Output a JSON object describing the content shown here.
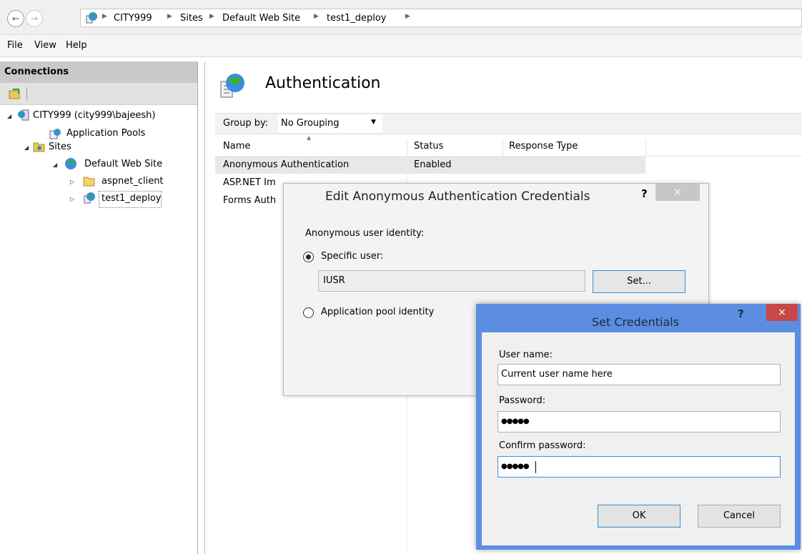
{
  "address": {
    "back_icon": "back-arrow-icon",
    "forward_icon": "forward-arrow-icon",
    "crumbs": [
      "CITY999",
      "Sites",
      "Default Web Site",
      "test1_deploy"
    ]
  },
  "menu": [
    "File",
    "View",
    "Help"
  ],
  "connections": {
    "title": "Connections",
    "tree": [
      "CITY999 (city999\\bajeesh)",
      "Application Pools",
      "Sites",
      "Default Web Site",
      "aspnet_client",
      "test1_deploy"
    ]
  },
  "main": {
    "title": "Authentication",
    "group_by_label": "Group by:",
    "group_by_value": "No Grouping",
    "columns": [
      "Name",
      "Status",
      "Response Type"
    ],
    "rows": [
      {
        "name": "Anonymous Authentication",
        "status": "Enabled",
        "response": ""
      },
      {
        "name": "ASP.NET Im",
        "status": "",
        "response": ""
      },
      {
        "name": "Forms Auth",
        "status": "",
        "response": ""
      }
    ]
  },
  "edit_dialog": {
    "title": "Edit Anonymous Authentication Credentials",
    "help": "?",
    "close": "×",
    "identity_label": "Anonymous user identity:",
    "specific_user_label": "Specific user:",
    "specific_user_value": "IUSR",
    "set_button": "Set...",
    "app_pool_label": "Application pool identity"
  },
  "cred_dialog": {
    "title": "Set Credentials",
    "help": "?",
    "close": "×",
    "username_label": "User name:",
    "username_value": "Current user name here",
    "password_label": "Password:",
    "password_value": "●●●●●",
    "confirm_label": "Confirm password:",
    "confirm_value": "●●●●●",
    "ok": "OK",
    "cancel": "Cancel"
  }
}
